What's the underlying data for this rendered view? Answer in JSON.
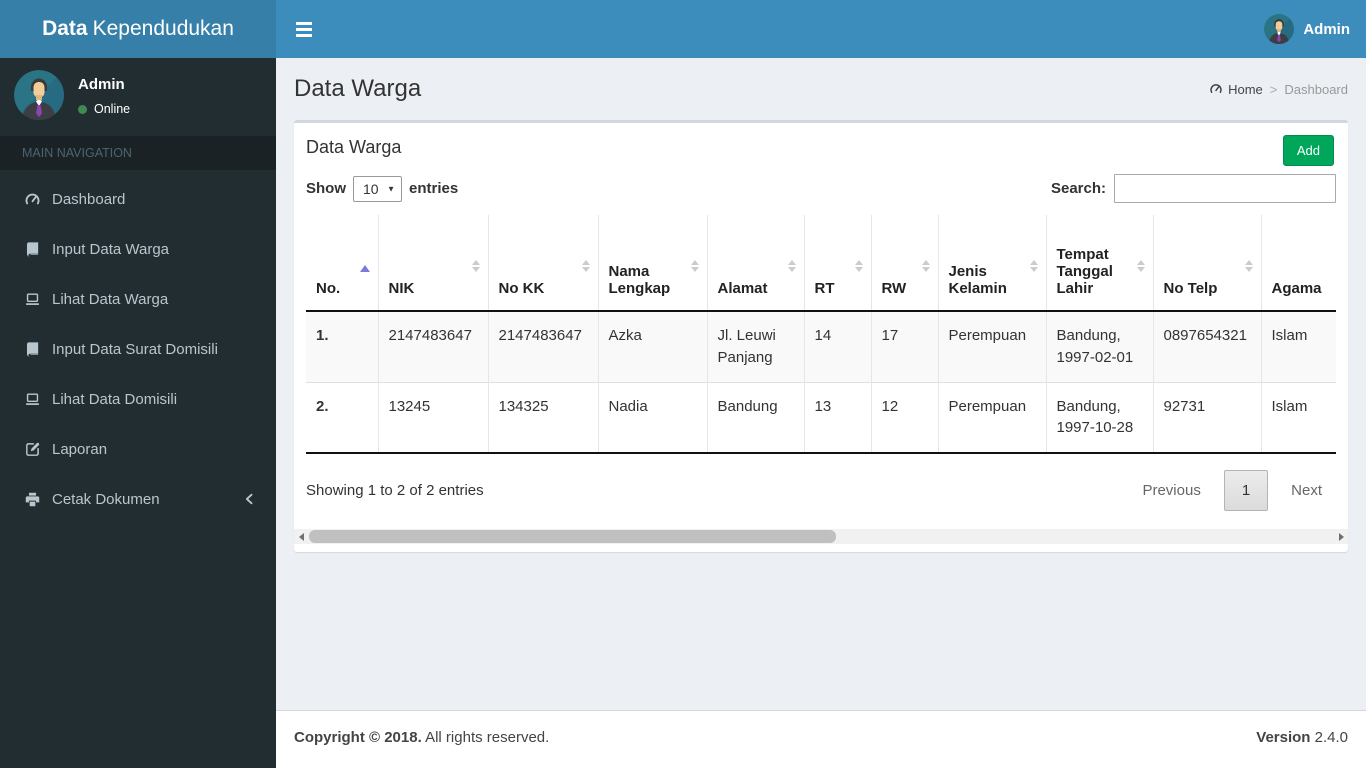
{
  "app": {
    "brand_bold": "Data",
    "brand_rest": "Kependudukan",
    "navbar_user": "Admin"
  },
  "colors": {
    "navbar": "#3c8dbc",
    "logo_bg": "#367fa9",
    "sidebar_bg": "#222d32",
    "accent_green": "#00a65a",
    "content_bg": "#ecf0f5",
    "online_dot": "#3d8b52",
    "sort_active_arrow": "#7b7bd9"
  },
  "icons": {
    "sidebar_toggle": "hamburger-menu",
    "navbar_user_avatar": "user-avatar",
    "sidebar_user_avatar": "user-avatar",
    "online_status": "green-dot",
    "breadcrumb_home": "tachometer",
    "menu_dashboard": "tachometer",
    "menu_input_data_warga": "book",
    "menu_lihat_data_warga": "laptop",
    "menu_input_data_surat_domisili": "book",
    "menu_lihat_data_domisili": "laptop",
    "menu_laporan": "edit-square",
    "menu_cetak_dokumen": "printer",
    "cetak_submenu_caret": "chevron-left",
    "sort_unsorted": "triangle-up-down",
    "sort_ascending": "triangle-up",
    "hscroll_left": "arrow-left",
    "hscroll_right": "arrow-right"
  },
  "sidebar": {
    "user": {
      "name": "Admin",
      "status": "Online"
    },
    "section_label": "MAIN NAVIGATION",
    "items": [
      {
        "label": "Dashboard"
      },
      {
        "label": "Input Data Warga"
      },
      {
        "label": "Lihat Data Warga"
      },
      {
        "label": "Input Data Surat Domisili"
      },
      {
        "label": "Lihat Data Domisili"
      },
      {
        "label": "Laporan"
      },
      {
        "label": "Cetak Dokumen"
      }
    ]
  },
  "content": {
    "page_title": "Data Warga",
    "breadcrumb": {
      "home": "Home",
      "separator": ">",
      "current": "Dashboard"
    },
    "box": {
      "title": "Data Warga",
      "add_button": "Add",
      "show_label": "Show",
      "page_length": "10",
      "entries_label": "entries",
      "search_label": "Search:",
      "search_value": ""
    },
    "table": {
      "columns": [
        "No.",
        "NIK",
        "No KK",
        "Nama Lengkap",
        "Alamat",
        "RT",
        "RW",
        "Jenis Kelamin",
        "Tempat Tanggal Lahir",
        "No Telp",
        "Agama"
      ],
      "sorted_column_index": 0,
      "sorted_direction": "asc",
      "rows": [
        [
          "1.",
          "2147483647",
          "2147483647",
          "Azka",
          "Jl. Leuwi Panjang",
          "14",
          "17",
          "Perempuan",
          "Bandung, 1997-02-01",
          "0897654321",
          "Islam"
        ],
        [
          "2.",
          "13245",
          "134325",
          "Nadia",
          "Bandung",
          "13",
          "12",
          "Perempuan",
          "Bandung, 1997-10-28",
          "92731",
          "Islam"
        ]
      ]
    },
    "pagination": {
      "info": "Showing 1 to 2 of 2 entries",
      "previous": "Previous",
      "current_page": "1",
      "next": "Next"
    }
  },
  "footer": {
    "copyright_bold": "Copyright © 2018.",
    "copyright_rest": " All rights reserved.",
    "version_label": "Version",
    "version_value": " 2.4.0"
  }
}
